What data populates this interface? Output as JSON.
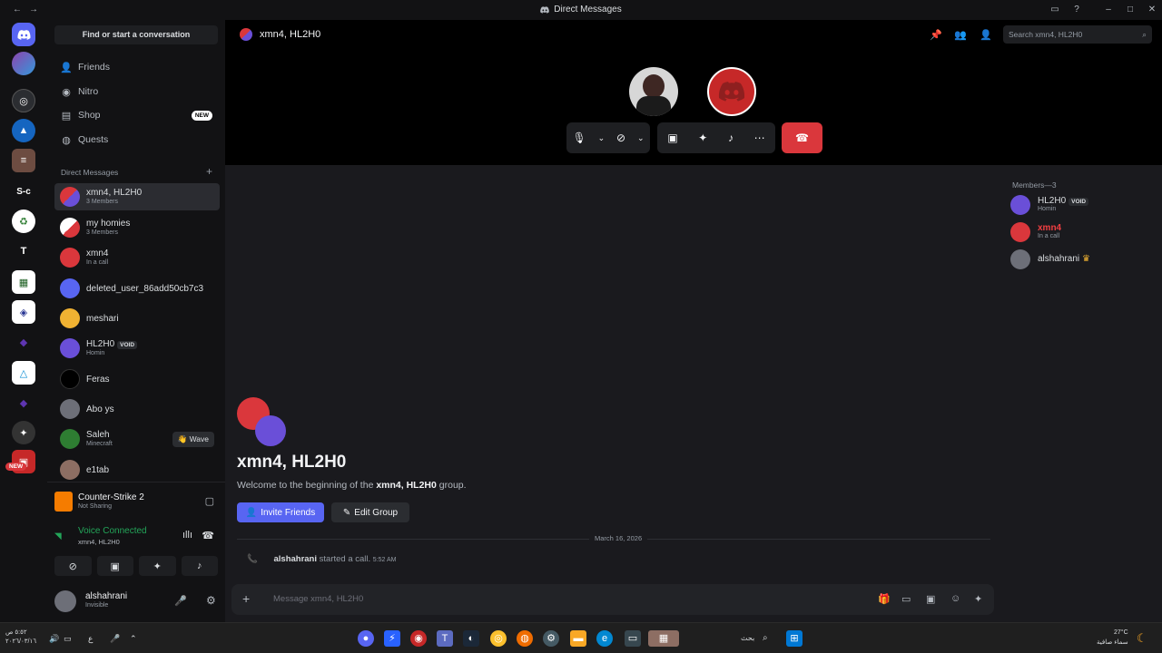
{
  "window": {
    "title": "Direct Messages"
  },
  "left_panel": {
    "find_placeholder": "Find or start a conversation",
    "nav": [
      {
        "label": "Friends",
        "icon": "friends-icon"
      },
      {
        "label": "Nitro",
        "icon": "nitro-icon"
      },
      {
        "label": "Shop",
        "icon": "shop-icon",
        "badge": "NEW"
      },
      {
        "label": "Quests",
        "icon": "quests-icon"
      }
    ],
    "dm_header": "Direct Messages",
    "dms": [
      {
        "name": "xmn4, HL2H0",
        "sub": "3 Members",
        "active": true
      },
      {
        "name": "my homies",
        "sub": "3 Members"
      },
      {
        "name": "xmn4",
        "sub": "In a call"
      },
      {
        "name": "deleted_user_86add50cb7c3",
        "sub": ""
      },
      {
        "name": "meshari",
        "sub": ""
      },
      {
        "name": "HL2H0",
        "tag": "VOID",
        "sub": "Homin"
      },
      {
        "name": "Feras",
        "sub": ""
      },
      {
        "name": "Abo ys",
        "sub": ""
      },
      {
        "name": "Saleh",
        "sub": "Minecraft",
        "wave": "Wave"
      },
      {
        "name": "e1tab",
        "sub": ""
      }
    ],
    "activity": {
      "game": "Counter-Strike 2",
      "status": "Not Sharing"
    },
    "voice": {
      "status": "Voice Connected",
      "channel": "xmn4, HL2H0"
    },
    "user": {
      "name": "alshahrani",
      "status": "Invisible"
    },
    "rail_new_badge": "NEW"
  },
  "header": {
    "channel": "xmn4, HL2H0",
    "search_placeholder": "Search xmn4, HL2H0"
  },
  "chat": {
    "group_title": "xmn4, HL2H0",
    "welcome_prefix": "Welcome to the beginning of the",
    "welcome_group": "xmn4, HL2H0",
    "welcome_suffix": "group.",
    "invite_label": "Invite Friends",
    "edit_label": "Edit Group",
    "date": "March 16, 2026",
    "call_user": "alshahrani",
    "call_text": "started a call.",
    "call_time": "5:52 AM",
    "message_placeholder": "Message xmn4, HL2H0"
  },
  "members": {
    "title": "Members—3",
    "list": [
      {
        "name": "HL2H0",
        "tag": "VOID",
        "sub": "Homin"
      },
      {
        "name": "xmn4",
        "sub": "In a call"
      },
      {
        "name": "alshahrani",
        "sub": ""
      }
    ]
  },
  "taskbar": {
    "search": "بحث",
    "weather_temp": "27°C",
    "weather_desc": "سماء صافية",
    "clock_time": "٥:٥٢ ص",
    "clock_date": "٢٠٢٦/٠٣/١٦",
    "lang": "ع"
  },
  "colors": {
    "accent": "#5865f2",
    "danger": "#da373c",
    "online": "#23a559"
  }
}
